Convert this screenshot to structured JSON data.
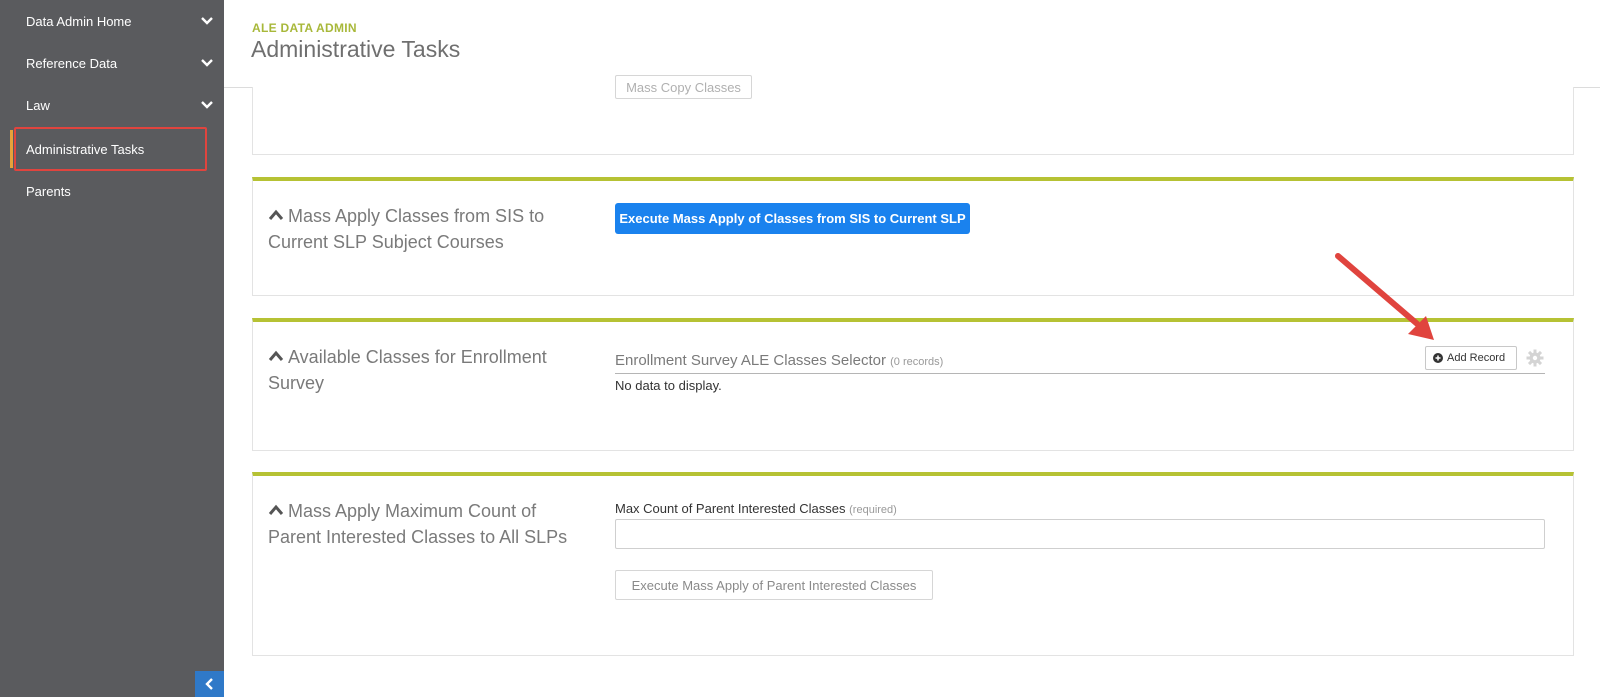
{
  "sidebar": {
    "items": [
      {
        "label": "Data Admin Home",
        "has_chevron": true
      },
      {
        "label": "Reference Data",
        "has_chevron": true
      },
      {
        "label": "Law",
        "has_chevron": true
      },
      {
        "label": "Administrative Tasks",
        "has_chevron": false,
        "active": true
      },
      {
        "label": "Parents",
        "has_chevron": false
      }
    ],
    "collapse_icon": "chevron-left-icon"
  },
  "header": {
    "app_name": "ALE DATA ADMIN",
    "page_title": "Administrative Tasks"
  },
  "panels": {
    "mass_copy": {
      "button_label": "Mass Copy Classes"
    },
    "mass_apply_sis": {
      "title": "Mass Apply Classes from SIS to Current SLP Subject Courses",
      "button_label": "Execute Mass Apply of Classes from SIS to Current SLP"
    },
    "available_classes": {
      "title": "Available Classes for Enrollment Survey",
      "selector_title": "Enrollment Survey ALE Classes Selector",
      "record_count": "(0 records)",
      "add_button_label": "Add Record",
      "empty_text": "No data to display."
    },
    "max_count": {
      "title": "Mass Apply Maximum Count of Parent Interested Classes to All SLPs",
      "field_label": "Max Count of Parent Interested Classes",
      "required_text": "(required)",
      "field_value": "",
      "button_label": "Execute Mass Apply of Parent Interested Classes"
    }
  },
  "colors": {
    "sidebar_bg": "#5a5b5e",
    "accent_green": "#b6c234",
    "primary_blue": "#1a82ee",
    "highlight_red": "#e0443e"
  }
}
